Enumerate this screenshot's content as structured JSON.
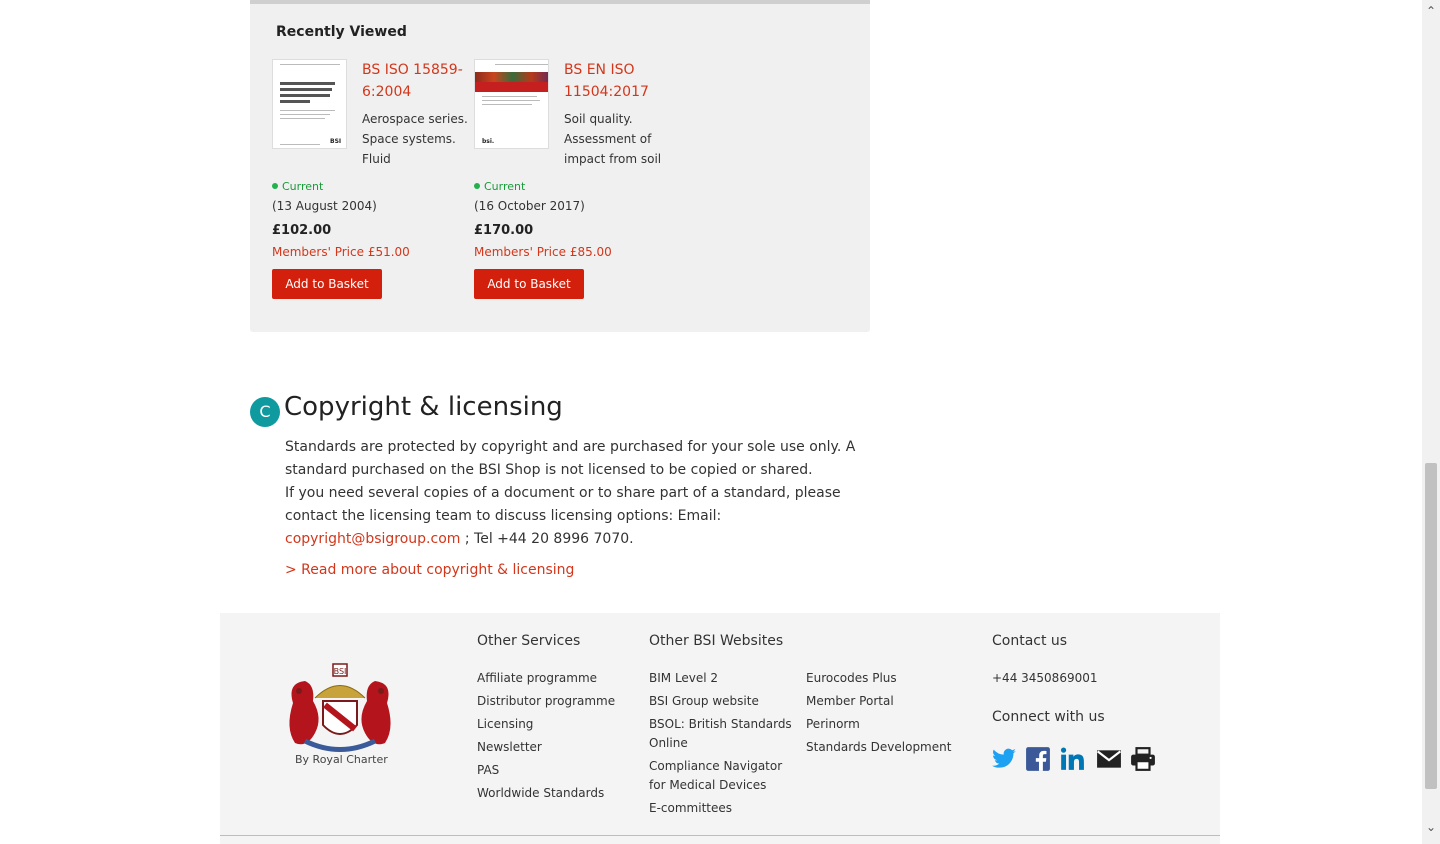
{
  "recently_viewed": {
    "title": "Recently Viewed",
    "products": [
      {
        "code": "BS ISO 15859-6:2004",
        "description": "Aerospace series. Space systems. Fluid",
        "status": "Current",
        "date": "(13 August 2004)",
        "price": "£102.00",
        "members_price": "Members' Price £51.00",
        "button": "Add to Basket"
      },
      {
        "code": "BS EN ISO 11504:2017",
        "description": "Soil quality. Assessment of impact from soil",
        "status": "Current",
        "date": "(16 October 2017)",
        "price": "£170.00",
        "members_price": "Members' Price £85.00",
        "button": "Add to Basket"
      }
    ]
  },
  "copyright": {
    "icon_letter": "C",
    "title": "Copyright & licensing",
    "para1": "Standards are protected by copyright and are purchased for your sole use only. A standard purchased on the BSI Shop is not licensed to be copied or shared.",
    "para2_a": "If you need several copies of a document or to share part of a standard, please contact the licensing team to discuss licensing options: Email: ",
    "email": "copyright@bsigroup.com",
    "para2_b": " ; Tel +44 20 8996 7070.",
    "read_more": "> Read more about copyright & licensing"
  },
  "footer": {
    "crest_caption": "By Royal Charter",
    "other_services": {
      "title": "Other Services",
      "items": [
        "Affiliate programme",
        "Distributor programme",
        "Licensing",
        "Newsletter",
        "PAS",
        "Worldwide Standards"
      ]
    },
    "other_websites": {
      "title": "Other BSI Websites",
      "col1": [
        "BIM Level 2",
        "BSI Group website",
        "BSOL: British Standards Online",
        "Compliance Navigator for Medical Devices",
        "E-committees"
      ],
      "col2": [
        "Eurocodes Plus",
        "Member Portal",
        "Perinorm",
        "Standards Development"
      ]
    },
    "contact": {
      "title": "Contact us",
      "phone": "+44 3450869001",
      "connect_title": "Connect with us",
      "icons": [
        "twitter-icon",
        "facebook-icon",
        "linkedin-icon",
        "email-icon",
        "print-icon"
      ]
    }
  },
  "colors": {
    "accent": "#d2371b",
    "button": "#d2200c",
    "teal": "#0f9aa0",
    "twitter": "#1da1f2",
    "facebook": "#3b5998",
    "linkedin": "#0077b5"
  }
}
